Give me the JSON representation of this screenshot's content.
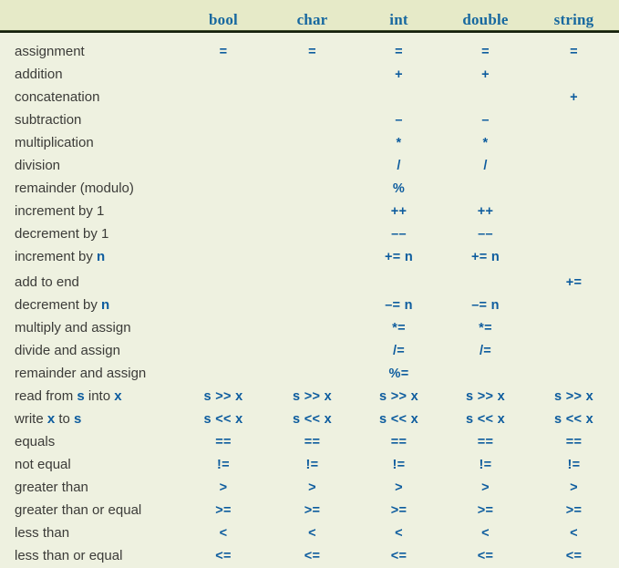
{
  "table": {
    "name": "cpp-operators-by-type",
    "columns": [
      {
        "key": "operation",
        "label": ""
      },
      {
        "key": "bool",
        "label": "bool"
      },
      {
        "key": "char",
        "label": "char"
      },
      {
        "key": "int",
        "label": "int"
      },
      {
        "key": "double",
        "label": "double"
      },
      {
        "key": "string",
        "label": "string"
      }
    ],
    "colors": {
      "header_background": "#e6eac8",
      "body_background": "#eef1e0",
      "rule": "#14200c",
      "header_text": "#17689f",
      "operator_text": "#0d5c9e",
      "label_text": "#3b3b38"
    },
    "rows": [
      {
        "label": "assignment",
        "label_html": "assignment",
        "bool": "=",
        "char": "=",
        "int": "=",
        "double": "=",
        "string": "=",
        "gap_before": false
      },
      {
        "label": "addition",
        "label_html": "addition",
        "bool": "",
        "char": "",
        "int": "+",
        "double": "+",
        "string": "",
        "gap_before": false
      },
      {
        "label": "concatenation",
        "label_html": "concatenation",
        "bool": "",
        "char": "",
        "int": "",
        "double": "",
        "string": "+",
        "gap_before": false
      },
      {
        "label": "subtraction",
        "label_html": "subtraction",
        "bool": "",
        "char": "",
        "int": "–",
        "double": "–",
        "string": "",
        "gap_before": false
      },
      {
        "label": "multiplication",
        "label_html": "multiplication",
        "bool": "",
        "char": "",
        "int": "*",
        "double": "*",
        "string": "",
        "gap_before": false
      },
      {
        "label": "division",
        "label_html": "division",
        "bool": "",
        "char": "",
        "int": "/",
        "double": "/",
        "string": "",
        "gap_before": false
      },
      {
        "label": "remainder (modulo)",
        "label_html": "remainder (modulo)",
        "bool": "",
        "char": "",
        "int": "%",
        "double": "",
        "string": "",
        "gap_before": false
      },
      {
        "label": "increment by 1",
        "label_html": "increment by 1",
        "bool": "",
        "char": "",
        "int": "++",
        "double": "++",
        "string": "",
        "gap_before": false
      },
      {
        "label": "decrement by 1",
        "label_html": "decrement by 1",
        "bool": "",
        "char": "",
        "int": "––",
        "double": "––",
        "string": "",
        "gap_before": false
      },
      {
        "label": "increment by n",
        "label_html": "increment by <b>n</b>",
        "bool": "",
        "char": "",
        "int": "+= n",
        "double": "+= n",
        "string": "",
        "gap_before": false
      },
      {
        "label": "add to end",
        "label_html": "add to end",
        "bool": "",
        "char": "",
        "int": "",
        "double": "",
        "string": "+=",
        "gap_before": true
      },
      {
        "label": "decrement by n",
        "label_html": "decrement by <b>n</b>",
        "bool": "",
        "char": "",
        "int": "–= n",
        "double": "–= n",
        "string": "",
        "gap_before": false
      },
      {
        "label": "multiply and assign",
        "label_html": "multiply and assign",
        "bool": "",
        "char": "",
        "int": "*=",
        "double": "*=",
        "string": "",
        "gap_before": false
      },
      {
        "label": "divide and assign",
        "label_html": "divide and assign",
        "bool": "",
        "char": "",
        "int": "/=",
        "double": "/=",
        "string": "",
        "gap_before": false
      },
      {
        "label": "remainder and assign",
        "label_html": "remainder and assign",
        "bool": "",
        "char": "",
        "int": "%=",
        "double": "",
        "string": "",
        "gap_before": false
      },
      {
        "label": "read from s into x",
        "label_html": "read from <b>s</b> into <b>x</b>",
        "bool": "s >> x",
        "char": "s >> x",
        "int": "s >> x",
        "double": "s >> x",
        "string": "s >> x",
        "gap_before": false
      },
      {
        "label": "write x to s",
        "label_html": "write <b>x</b> to <b>s</b>",
        "bool": "s << x",
        "char": "s << x",
        "int": "s << x",
        "double": "s << x",
        "string": "s << x",
        "gap_before": false
      },
      {
        "label": "equals",
        "label_html": "equals",
        "bool": "==",
        "char": "==",
        "int": "==",
        "double": "==",
        "string": "==",
        "gap_before": false
      },
      {
        "label": "not equal",
        "label_html": "not equal",
        "bool": "!=",
        "char": "!=",
        "int": "!=",
        "double": "!=",
        "string": "!=",
        "gap_before": false
      },
      {
        "label": "greater than",
        "label_html": "greater than",
        "bool": ">",
        "char": ">",
        "int": ">",
        "double": ">",
        "string": ">",
        "gap_before": false
      },
      {
        "label": "greater than or equal",
        "label_html": "greater than or equal",
        "bool": ">=",
        "char": ">=",
        "int": ">=",
        "double": ">=",
        "string": ">=",
        "gap_before": false
      },
      {
        "label": "less than",
        "label_html": "less than",
        "bool": "<",
        "char": "<",
        "int": "<",
        "double": "<",
        "string": "<",
        "gap_before": false
      },
      {
        "label": "less than or equal",
        "label_html": "less than or equal",
        "bool": "<=",
        "char": "<=",
        "int": "<=",
        "double": "<=",
        "string": "<=",
        "gap_before": false
      }
    ]
  }
}
